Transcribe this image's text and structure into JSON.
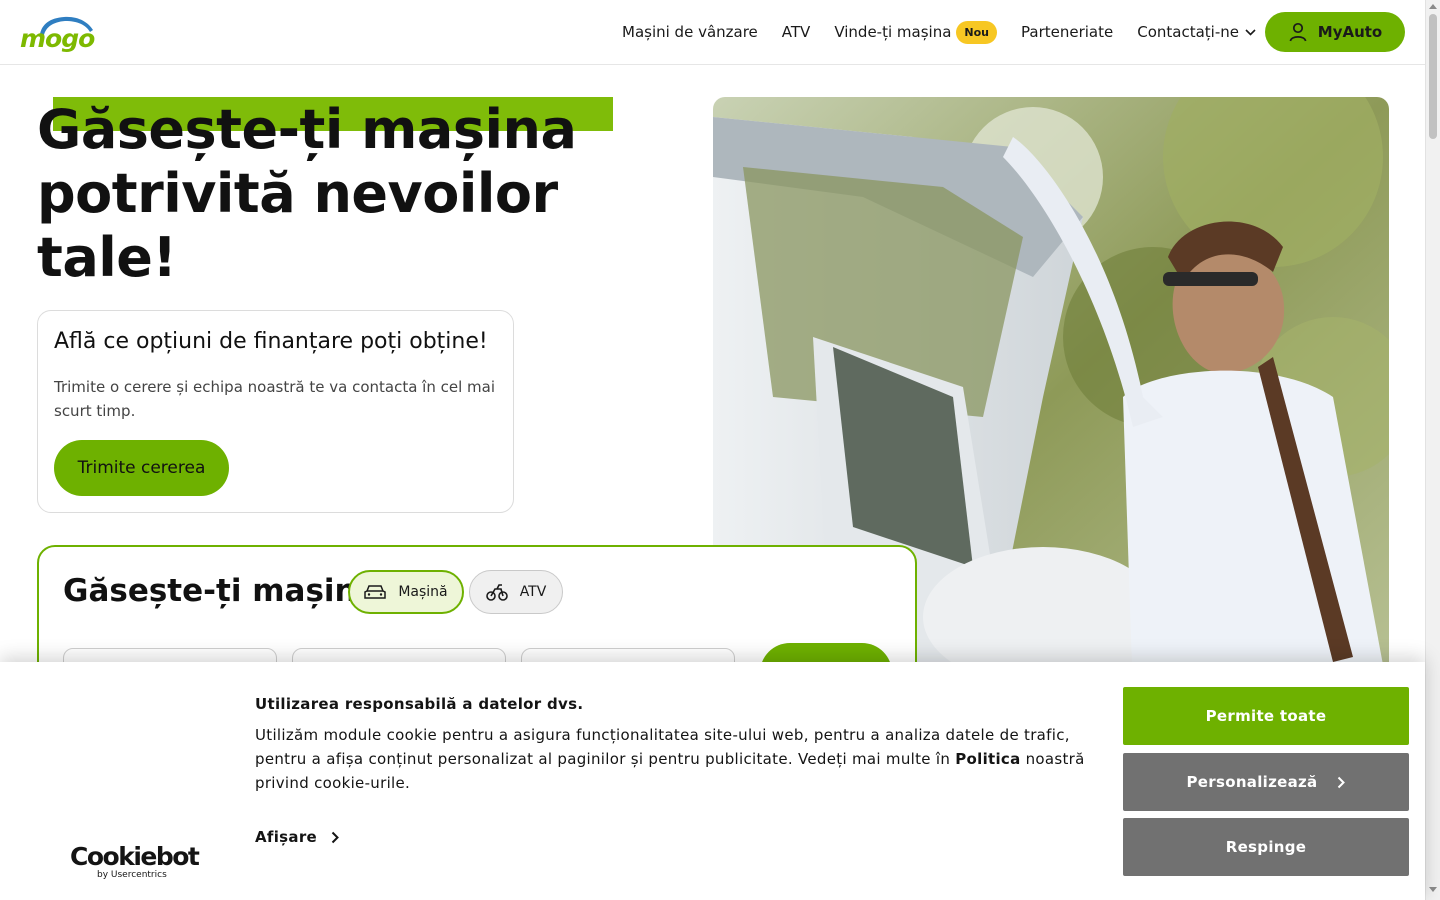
{
  "brand": {
    "logo_text": "mogo",
    "accent_color": "#6eb100"
  },
  "nav": {
    "items": [
      {
        "label": "Mașini de vânzare"
      },
      {
        "label": "ATV"
      },
      {
        "label": "Vinde-ți mașina",
        "badge": "Nou"
      },
      {
        "label": "Parteneriate"
      },
      {
        "label": "Contactați-ne",
        "icon": "chevron-down-icon"
      }
    ],
    "account_button": {
      "label": "MyAuto",
      "icon": "user-icon"
    }
  },
  "hero": {
    "title": "Găsește-ți mașina potrivită nevoilor tale!"
  },
  "financing_card": {
    "title": "Află ce opțiuni de finanțare poți obține!",
    "text": "Trimite o cerere și echipa noastră te va contacta în cel mai scurt timp.",
    "button": "Trimite cererea"
  },
  "search": {
    "title": "Găsește-ți mașina",
    "tabs": [
      {
        "label": "Mașină",
        "icon": "car-icon",
        "selected": true
      },
      {
        "label": "ATV",
        "icon": "atv-icon",
        "selected": false
      }
    ]
  },
  "cookie_banner": {
    "title": "Utilizarea responsabilă a datelor dvs.",
    "text_before": "Utilizăm module cookie pentru a asigura funcționalitatea site-ului web, pentru a analiza datele de trafic, pentru a afișa conținut personalizat al paginilor și pentru publicitate. Vedeți mai multe în ",
    "text_link": "Politica",
    "text_after": " noastră privind cookie-urile.",
    "show_details": "Afișare",
    "buttons": {
      "allow_all": "Permite toate",
      "customize": "Personalizează",
      "deny": "Respinge"
    },
    "provider": {
      "name": "Cookiebot",
      "subtitle": "by Usercentrics"
    }
  }
}
